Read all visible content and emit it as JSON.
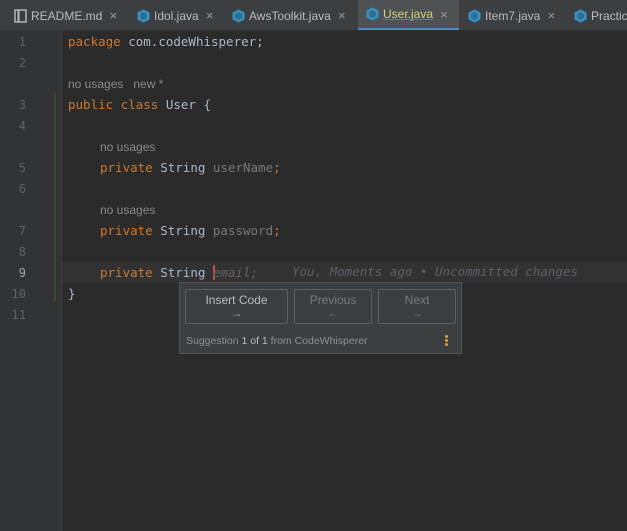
{
  "tabs": [
    {
      "label": "README.md",
      "icon": "markdown-file-icon",
      "active": false
    },
    {
      "label": "Idol.java",
      "icon": "java-class-icon",
      "active": false
    },
    {
      "label": "AwsToolkit.java",
      "icon": "java-class-icon",
      "active": false
    },
    {
      "label": "User.java",
      "icon": "java-class-icon",
      "active": true
    },
    {
      "label": "Item7.java",
      "icon": "java-class-icon",
      "active": false
    },
    {
      "label": "Practic",
      "icon": "java-class-icon",
      "active": false
    }
  ],
  "close_glyph": "×",
  "line_numbers": [
    "1",
    "2",
    "3",
    "4",
    "5",
    "6",
    "7",
    "8",
    "9",
    "10",
    "11"
  ],
  "code": {
    "l1_kw": "package",
    "l1_rest": " com.codeWhisperer;",
    "hint_class": "no usages   new *",
    "l3_kw": "public class",
    "l3_rest": " User {",
    "hint_field1": "no usages",
    "l5_kw": "private",
    "l5_type": " String ",
    "l5_name": "userName",
    "l5_end": ";",
    "hint_field2": "no usages",
    "l7_kw": "private",
    "l7_type": " String ",
    "l7_name": "password",
    "l7_end": ";",
    "l9_kw": "private",
    "l9_type": " String ",
    "l9_ghost": "email;",
    "l10": "}",
    "blame": "You, Moments ago • Uncommitted changes"
  },
  "popup": {
    "insert_label": "Insert Code",
    "insert_arrow": "→",
    "previous_label": "Previous",
    "previous_arrow": "←",
    "next_label": "Next",
    "next_arrow": "→",
    "footer_prefix": "Suggestion ",
    "footer_index": "1 of 1",
    "footer_suffix": " from CodeWhisperer",
    "more_icon": "vertical-dots-icon"
  },
  "colors": {
    "keyword": "#cc7832",
    "accent_tab": "#4a88c7",
    "more_icon": "#d9a343"
  }
}
